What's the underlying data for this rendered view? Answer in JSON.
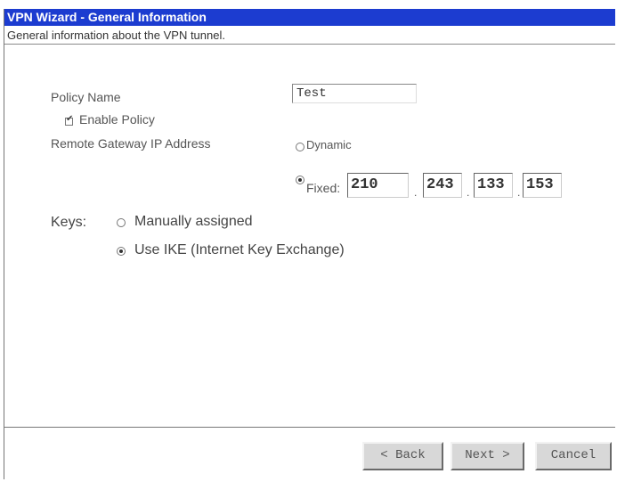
{
  "window": {
    "title": "VPN Wizard - General Information",
    "subtitle": "General information about the VPN tunnel."
  },
  "form": {
    "policy_name_label": "Policy Name",
    "policy_name_value": "Test",
    "enable_policy_label": "Enable Policy",
    "enable_policy_checked": true,
    "remote_gateway_label": "Remote Gateway IP Address",
    "gateway_options": {
      "dynamic_label": "Dynamic",
      "fixed_label": "Fixed:",
      "selected": "Fixed:"
    },
    "fixed_ip": [
      "210",
      "243",
      "133",
      "153"
    ],
    "ip_separator": ".",
    "keys_label": "Keys:",
    "keys_options": {
      "manual_label": "Manually assigned",
      "ike_label": "Use IKE (Internet Key Exchange)",
      "selected": "Use IKE (Internet Key Exchange)"
    }
  },
  "buttons": {
    "back": "< Back",
    "next": "Next >",
    "cancel": "Cancel"
  }
}
